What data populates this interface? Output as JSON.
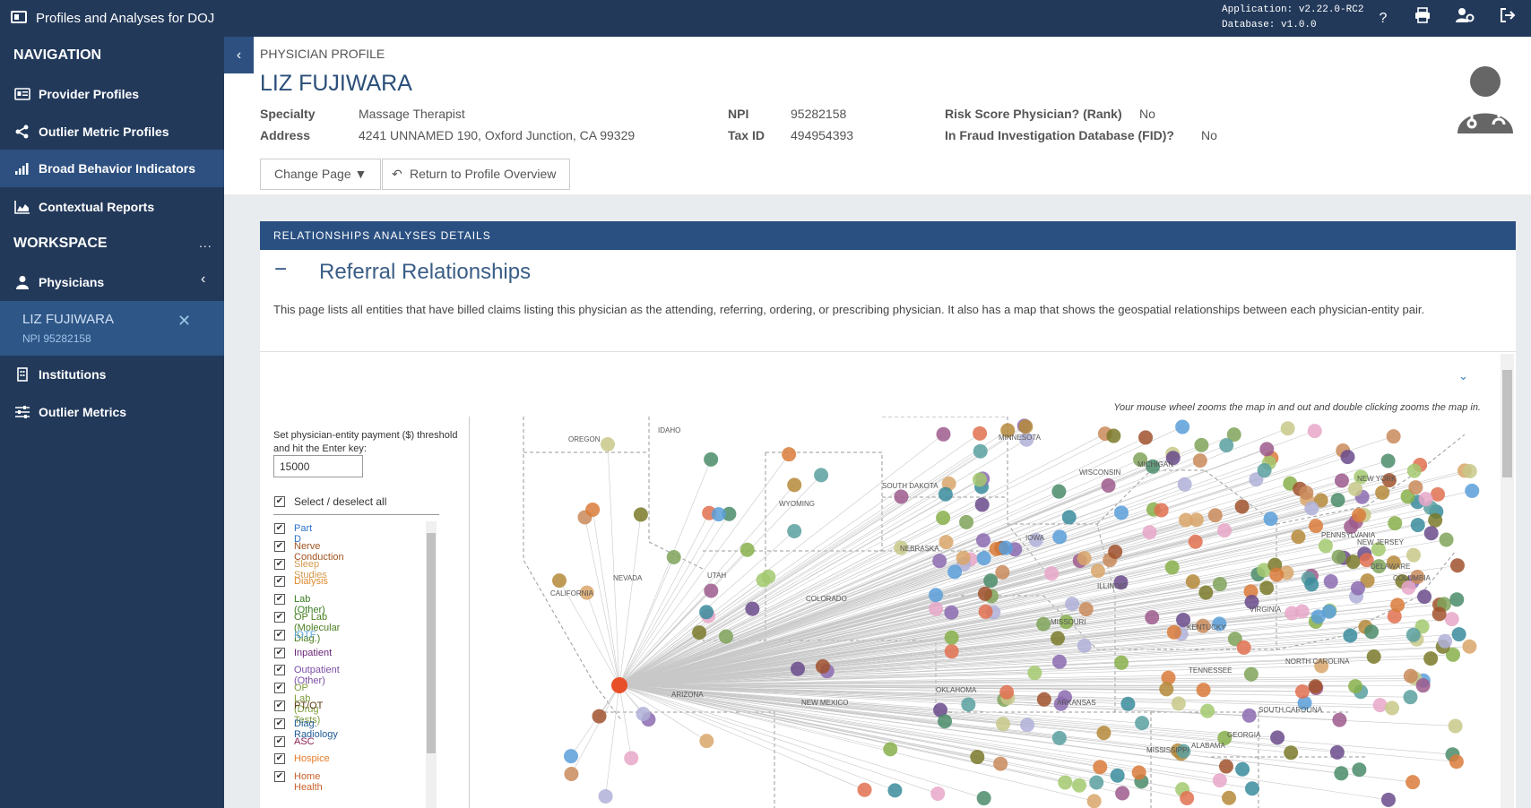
{
  "app": {
    "title": "Profiles and Analyses for DOJ",
    "version_application": "Application: v2.22.0-RC2",
    "version_database": "Database: v1.0.0"
  },
  "nav": {
    "heading": "NAVIGATION",
    "items": [
      {
        "label": "Provider Profiles",
        "icon": "id-card-icon"
      },
      {
        "label": "Outlier Metric Profiles",
        "icon": "share-icon"
      },
      {
        "label": "Broad Behavior Indicators",
        "icon": "signal-bars-icon"
      },
      {
        "label": "Contextual Reports",
        "icon": "area-chart-icon"
      }
    ]
  },
  "workspace": {
    "heading": "WORKSPACE",
    "dots": "...",
    "physicians_label": "Physicians",
    "entry_name": "LIZ FUJIWARA",
    "entry_npi": "NPI 95282158",
    "institutions_label": "Institutions",
    "outlier_metrics_label": "Outlier Metrics"
  },
  "profile": {
    "crumb": "PHYSICIAN PROFILE",
    "name": "LIZ FUJIWARA",
    "specialty_label": "Specialty",
    "specialty": "Massage Therapist",
    "address_label": "Address",
    "address": "4241 UNNAMED 190, Oxford Junction, CA 99329",
    "npi_label": "NPI",
    "npi": "95282158",
    "taxid_label": "Tax ID",
    "taxid": "494954393",
    "risk_label": "Risk Score Physician? (Rank)",
    "risk": "No",
    "fid_label": "In Fraud Investigation Database (FID)?",
    "fid": "No",
    "change_page": "Change Page ▼",
    "return_overview": "Return to Profile Overview"
  },
  "panel": {
    "bar_title": "RELATIONSHIPS ANALYSES DETAILS",
    "section_title": "Referral Relationships",
    "description": "This page lists all entities that have billed claims listing this physician as the attending, referring, ordering, or prescribing physician. It also has a map that shows the geospatial relationships between each physician-entity pair.",
    "map_hint": "Your mouse wheel zooms the map in and out and double clicking zooms the map in.",
    "threshold_label": "Set physician-entity payment ($) threshold and hit the Enter key:",
    "threshold_value": "15000",
    "select_all": "Select / deselect all"
  },
  "categories": [
    {
      "label": "Part D",
      "color": "#2a73c9"
    },
    {
      "label": "Nerve Conduction",
      "color": "#a0521d"
    },
    {
      "label": "Sleep Studies",
      "color": "#d39a4e"
    },
    {
      "label": "Dialysis",
      "color": "#e08a2e"
    },
    {
      "label": "Lab (Other)",
      "color": "#3a7d23"
    },
    {
      "label": "OP Lab (Molecular Diag.)",
      "color": "#4b7e1e"
    },
    {
      "label": "IDTF",
      "color": "#5ea7e0"
    },
    {
      "label": "Inpatient",
      "color": "#6a2378"
    },
    {
      "label": "Outpatient (Other)",
      "color": "#7b4fa5"
    },
    {
      "label": "OP Lab (Drug Tests)",
      "color": "#7d9c3a"
    },
    {
      "label": "PT/OT",
      "color": "#5b3a12"
    },
    {
      "label": "Diag. Radiology",
      "color": "#1f5a96"
    },
    {
      "label": "ASC",
      "color": "#8a1f55"
    },
    {
      "label": "Hospice",
      "color": "#e87b2a"
    },
    {
      "label": "Home Health",
      "color": "#c8602a"
    }
  ],
  "map": {
    "state_labels": [
      "OREGON",
      "IDAHO",
      "MINNESOTA",
      "WISCONSIN",
      "MICHIGAN",
      "SOUTH DAKOTA",
      "WYOMING",
      "NEBRASKA",
      "IOWA",
      "NEVADA",
      "UTAH",
      "CALIFORNIA",
      "COLORADO",
      "ILLINOIS",
      "MISSOURI",
      "KENTUCKY",
      "VIRGINIA",
      "NORTH CAROLINA",
      "TENNESSEE",
      "ARKANSAS",
      "OKLAHOMA",
      "NEW MEXICO",
      "ARIZONA",
      "SOUTH CAROLINA",
      "MISSISSIPPI",
      "ALABAMA",
      "GEORGIA",
      "NEW YORK",
      "PENNSYLVANIA",
      "NEW JERSEY",
      "DELAWARE",
      "COLUMBIA"
    ],
    "colors": [
      "#7fa35a",
      "#c98a5a",
      "#e8a7c8",
      "#5b9fd9",
      "#a3c96e",
      "#8c6bb0",
      "#d97b3a",
      "#4b8c6a",
      "#b58a3a",
      "#6a4b8c",
      "#c8c88a",
      "#3a8c9c",
      "#d9a66a",
      "#9c5a8c",
      "#7a7a2a",
      "#5aa0a0",
      "#b0b0d8",
      "#e07050",
      "#88b04b",
      "#a0522d"
    ]
  }
}
